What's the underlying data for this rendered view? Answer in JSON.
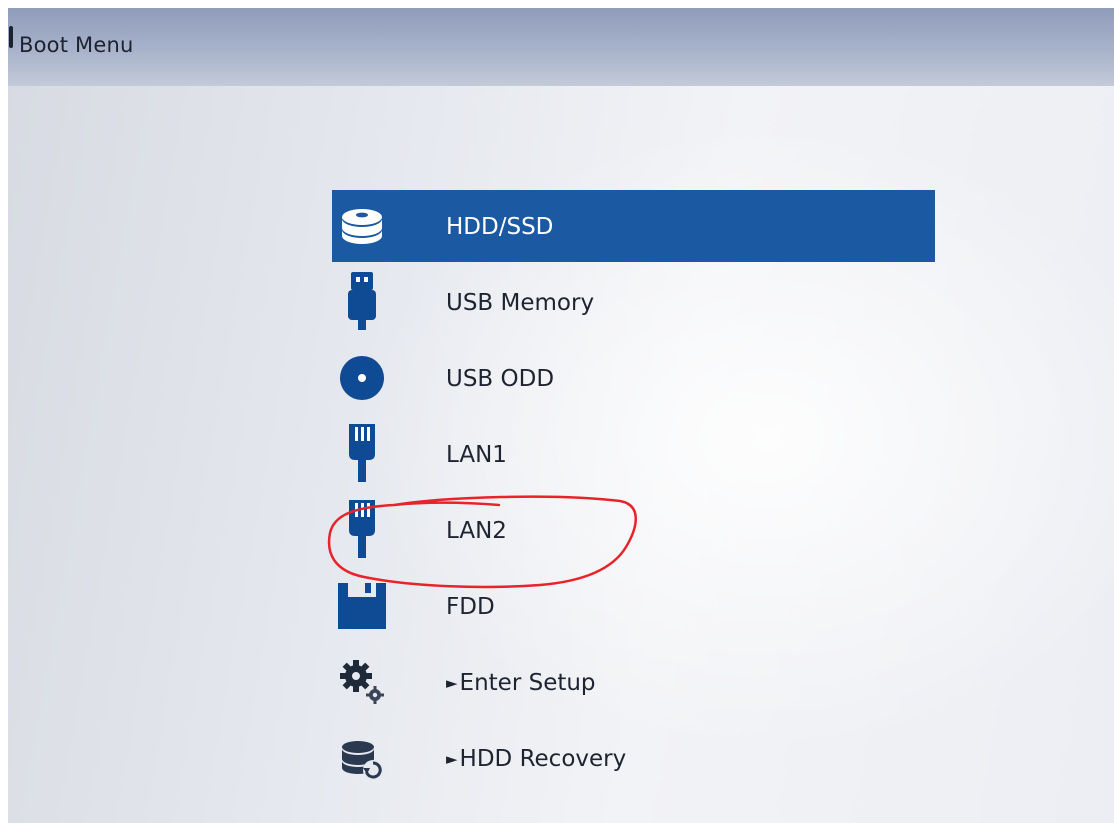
{
  "window": {
    "title": "Boot Menu"
  },
  "colors": {
    "selection": "#1b5aa3",
    "icon_blue": "#0f4a94",
    "annotation": "#e8232a"
  },
  "menu": {
    "selected_index": 0,
    "items": [
      {
        "label": "HDD/SSD",
        "icon": "hdd-stack-icon"
      },
      {
        "label": "USB Memory",
        "icon": "usb-memory-icon"
      },
      {
        "label": "USB ODD",
        "icon": "optical-disc-icon"
      },
      {
        "label": "LAN1",
        "icon": "lan-plug-icon"
      },
      {
        "label": "LAN2",
        "icon": "lan-plug-icon"
      },
      {
        "label": "FDD",
        "icon": "floppy-icon"
      },
      {
        "label": "Enter Setup",
        "icon": "gears-icon",
        "arrow": "►"
      },
      {
        "label": "HDD Recovery",
        "icon": "hdd-recovery-icon",
        "arrow": "►"
      }
    ]
  }
}
